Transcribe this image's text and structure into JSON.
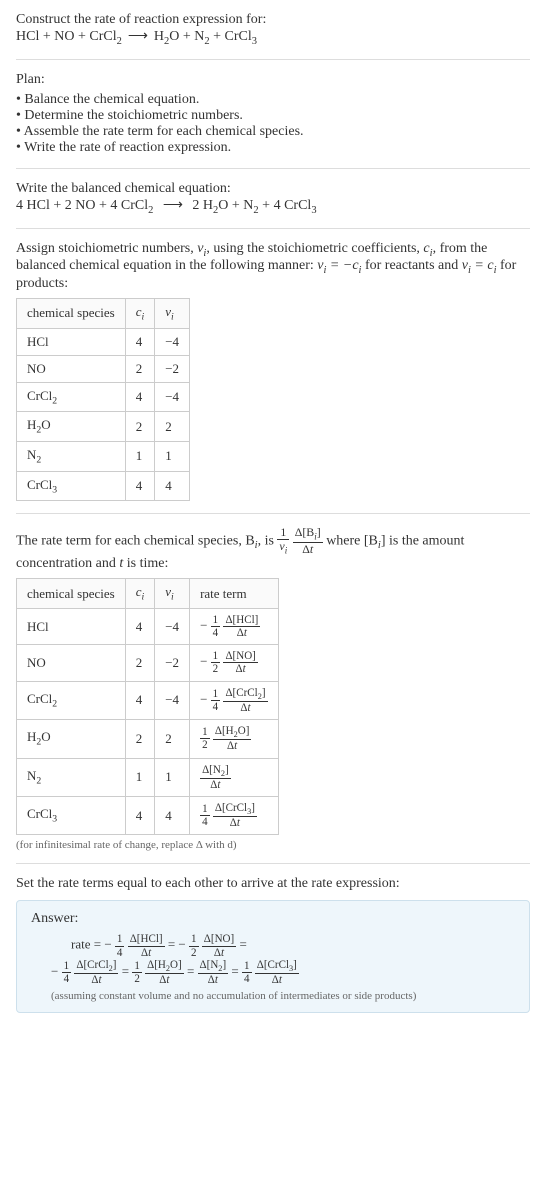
{
  "intro": {
    "prompt": "Construct the rate of reaction expression for:",
    "lhs": [
      "HCl",
      "NO",
      "CrCl",
      "2"
    ],
    "rhs": [
      "H",
      "2",
      "O",
      "N",
      "2",
      "CrCl",
      "3"
    ]
  },
  "plan": {
    "title": "Plan:",
    "items": [
      "Balance the chemical equation.",
      "Determine the stoichiometric numbers.",
      "Assemble the rate term for each chemical species.",
      "Write the rate of reaction expression."
    ]
  },
  "balanced": {
    "title": "Write the balanced chemical equation:",
    "c": {
      "hcl": "4",
      "no": "2",
      "crcl2": "4",
      "h2o": "2",
      "n2": "",
      "crcl3": "4"
    },
    "n2coef": "N"
  },
  "stoich": {
    "intro_a": "Assign stoichiometric numbers, ",
    "intro_b": ", using the stoichiometric coefficients, ",
    "intro_c": ", from the balanced chemical equation in the following manner: ",
    "intro_d": " for reactants and ",
    "intro_e": " for products:",
    "headers": {
      "sp": "chemical species",
      "c": "c",
      "v": "ν"
    },
    "rows": [
      {
        "sp": "HCl",
        "c": "4",
        "v": "−4",
        "sub": ""
      },
      {
        "sp": "NO",
        "c": "2",
        "v": "−2",
        "sub": ""
      },
      {
        "sp": "CrCl",
        "c": "4",
        "v": "−4",
        "sub": "2"
      },
      {
        "sp": "H",
        "c": "2",
        "v": "2",
        "sub": "2",
        "suffix": "O"
      },
      {
        "sp": "N",
        "c": "1",
        "v": "1",
        "sub": "2"
      },
      {
        "sp": "CrCl",
        "c": "4",
        "v": "4",
        "sub": "3"
      }
    ]
  },
  "rateterm": {
    "intro_a": "The rate term for each chemical species, B",
    "intro_b": ", is ",
    "intro_c": " where [B",
    "intro_d": "] is the amount concentration and ",
    "intro_e": " is time:",
    "headers": {
      "sp": "chemical species",
      "c": "c",
      "v": "ν",
      "rt": "rate term"
    },
    "rows": [
      {
        "sp": "HCl",
        "sub": "",
        "suffix": "",
        "c": "4",
        "v": "−4",
        "sign": "− ",
        "ftop": "1",
        "fbot": "4",
        "d": "Δ[HCl]"
      },
      {
        "sp": "NO",
        "sub": "",
        "suffix": "",
        "c": "2",
        "v": "−2",
        "sign": "− ",
        "ftop": "1",
        "fbot": "2",
        "d": "Δ[NO]"
      },
      {
        "sp": "CrCl",
        "sub": "2",
        "suffix": "",
        "c": "4",
        "v": "−4",
        "sign": "− ",
        "ftop": "1",
        "fbot": "4",
        "d": "Δ[CrCl2]"
      },
      {
        "sp": "H",
        "sub": "2",
        "suffix": "O",
        "c": "2",
        "v": "2",
        "sign": "",
        "ftop": "1",
        "fbot": "2",
        "d": "Δ[H2O]"
      },
      {
        "sp": "N",
        "sub": "2",
        "suffix": "",
        "c": "1",
        "v": "1",
        "sign": "",
        "ftop": "",
        "fbot": "",
        "d": "Δ[N2]"
      },
      {
        "sp": "CrCl",
        "sub": "3",
        "suffix": "",
        "c": "4",
        "v": "4",
        "sign": "",
        "ftop": "1",
        "fbot": "4",
        "d": "Δ[CrCl3]"
      }
    ],
    "note": "(for infinitesimal rate of change, replace Δ with d)"
  },
  "final": {
    "title": "Set the rate terms equal to each other to arrive at the rate expression:",
    "answer_label": "Answer:",
    "rate_word": "rate",
    "note": "(assuming constant volume and no accumulation of intermediates or side products)"
  },
  "sym": {
    "nu": "ν",
    "ci": "c",
    "i": "i",
    "delta": "Δ",
    "t": "t",
    "eq": " = ",
    "minus": "−",
    "plus": " + "
  }
}
